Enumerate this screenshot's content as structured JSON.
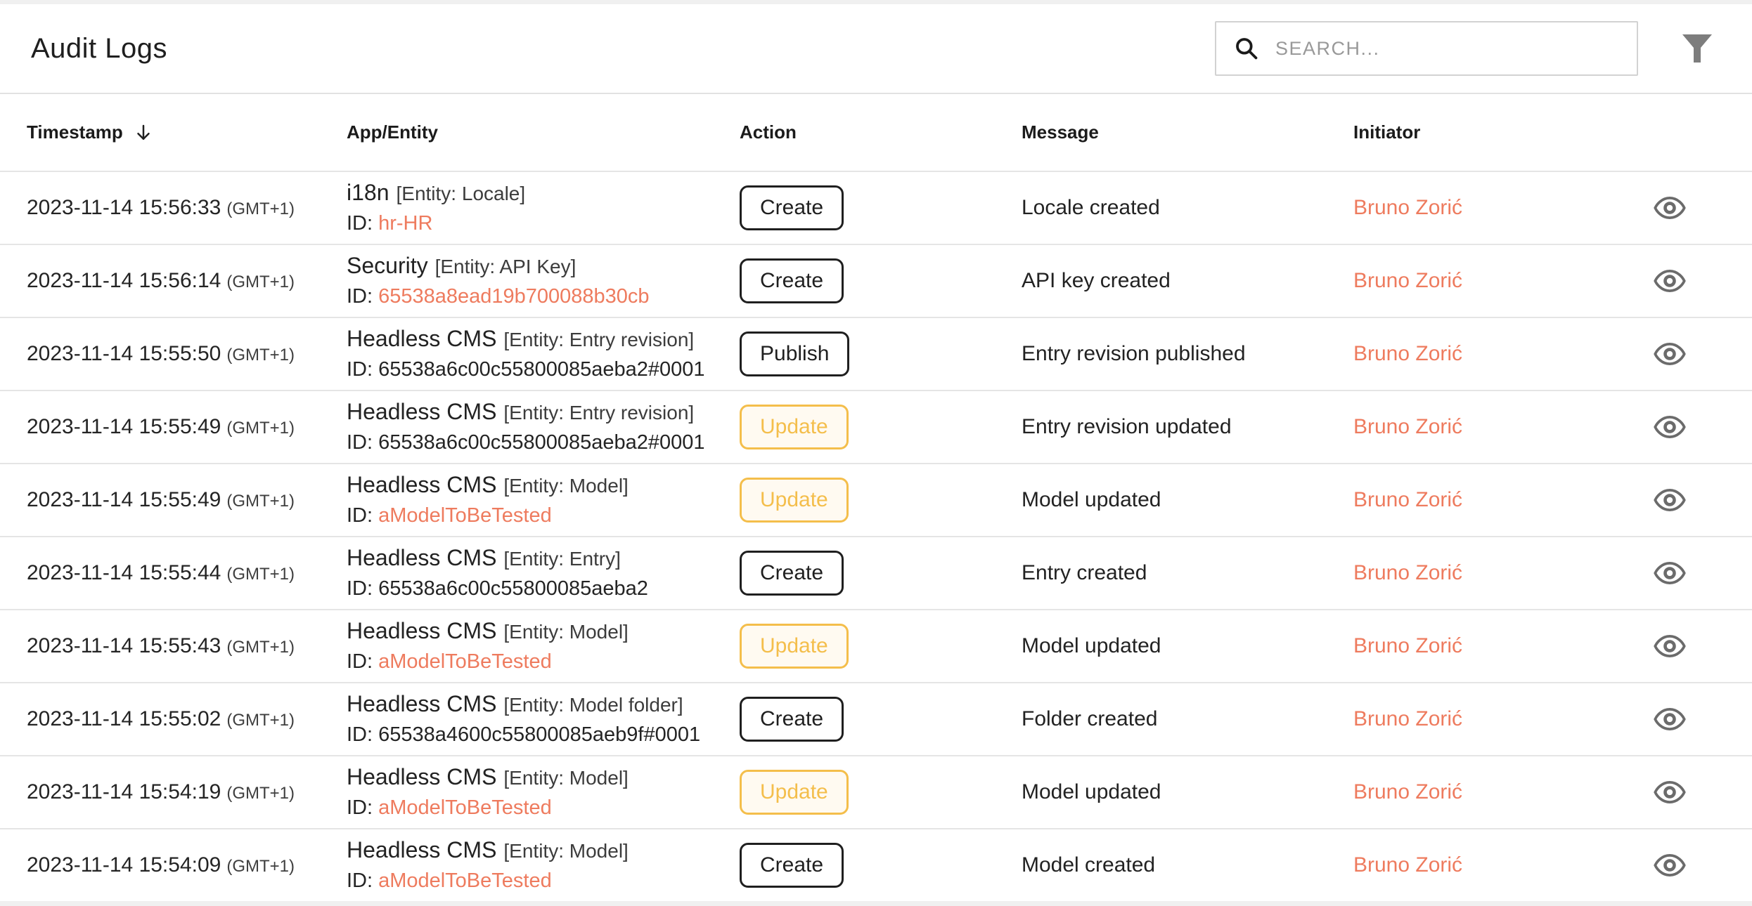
{
  "page": {
    "title": "Audit Logs"
  },
  "search": {
    "placeholder": "SEARCH..."
  },
  "colors": {
    "link_accent": "#ee7b5e",
    "warning_badge": "#f4be4b",
    "default_badge": "#1f1f1f",
    "icon_gray": "#6b6b6b"
  },
  "icons": {
    "search": "magnifier",
    "filter": "funnel",
    "sort": "arrow-down",
    "view": "eye"
  },
  "table": {
    "columns": {
      "timestamp": "Timestamp",
      "app_entity": "App/Entity",
      "action": "Action",
      "message": "Message",
      "initiator": "Initiator"
    },
    "rows": [
      {
        "timestamp": "2023-11-14 15:56:33",
        "timezone": "(GMT+1)",
        "app": "i18n",
        "entity": "[Entity: Locale]",
        "id_label": "ID:",
        "id_value": "hr-HR",
        "id_is_link": true,
        "action": "Create",
        "action_variant": "default",
        "message": "Locale created",
        "initiator": "Bruno Zorić"
      },
      {
        "timestamp": "2023-11-14 15:56:14",
        "timezone": "(GMT+1)",
        "app": "Security",
        "entity": "[Entity: API Key]",
        "id_label": "ID:",
        "id_value": "65538a8ead19b700088b30cb",
        "id_is_link": true,
        "action": "Create",
        "action_variant": "default",
        "message": "API key created",
        "initiator": "Bruno Zorić"
      },
      {
        "timestamp": "2023-11-14 15:55:50",
        "timezone": "(GMT+1)",
        "app": "Headless CMS",
        "entity": "[Entity: Entry revision]",
        "id_label": "ID:",
        "id_value": "65538a6c00c55800085aeba2#0001",
        "id_is_link": false,
        "action": "Publish",
        "action_variant": "default",
        "message": "Entry revision published",
        "initiator": "Bruno Zorić"
      },
      {
        "timestamp": "2023-11-14 15:55:49",
        "timezone": "(GMT+1)",
        "app": "Headless CMS",
        "entity": "[Entity: Entry revision]",
        "id_label": "ID:",
        "id_value": "65538a6c00c55800085aeba2#0001",
        "id_is_link": false,
        "action": "Update",
        "action_variant": "warning",
        "message": "Entry revision updated",
        "initiator": "Bruno Zorić"
      },
      {
        "timestamp": "2023-11-14 15:55:49",
        "timezone": "(GMT+1)",
        "app": "Headless CMS",
        "entity": "[Entity: Model]",
        "id_label": "ID:",
        "id_value": "aModelToBeTested",
        "id_is_link": true,
        "action": "Update",
        "action_variant": "warning",
        "message": "Model updated",
        "initiator": "Bruno Zorić"
      },
      {
        "timestamp": "2023-11-14 15:55:44",
        "timezone": "(GMT+1)",
        "app": "Headless CMS",
        "entity": "[Entity: Entry]",
        "id_label": "ID:",
        "id_value": "65538a6c00c55800085aeba2",
        "id_is_link": false,
        "action": "Create",
        "action_variant": "default",
        "message": "Entry created",
        "initiator": "Bruno Zorić"
      },
      {
        "timestamp": "2023-11-14 15:55:43",
        "timezone": "(GMT+1)",
        "app": "Headless CMS",
        "entity": "[Entity: Model]",
        "id_label": "ID:",
        "id_value": "aModelToBeTested",
        "id_is_link": true,
        "action": "Update",
        "action_variant": "warning",
        "message": "Model updated",
        "initiator": "Bruno Zorić"
      },
      {
        "timestamp": "2023-11-14 15:55:02",
        "timezone": "(GMT+1)",
        "app": "Headless CMS",
        "entity": "[Entity: Model folder]",
        "id_label": "ID:",
        "id_value": "65538a4600c55800085aeb9f#0001",
        "id_is_link": false,
        "action": "Create",
        "action_variant": "default",
        "message": "Folder created",
        "initiator": "Bruno Zorić"
      },
      {
        "timestamp": "2023-11-14 15:54:19",
        "timezone": "(GMT+1)",
        "app": "Headless CMS",
        "entity": "[Entity: Model]",
        "id_label": "ID:",
        "id_value": "aModelToBeTested",
        "id_is_link": true,
        "action": "Update",
        "action_variant": "warning",
        "message": "Model updated",
        "initiator": "Bruno Zorić"
      },
      {
        "timestamp": "2023-11-14 15:54:09",
        "timezone": "(GMT+1)",
        "app": "Headless CMS",
        "entity": "[Entity: Model]",
        "id_label": "ID:",
        "id_value": "aModelToBeTested",
        "id_is_link": true,
        "action": "Create",
        "action_variant": "default",
        "message": "Model created",
        "initiator": "Bruno Zorić"
      }
    ]
  }
}
